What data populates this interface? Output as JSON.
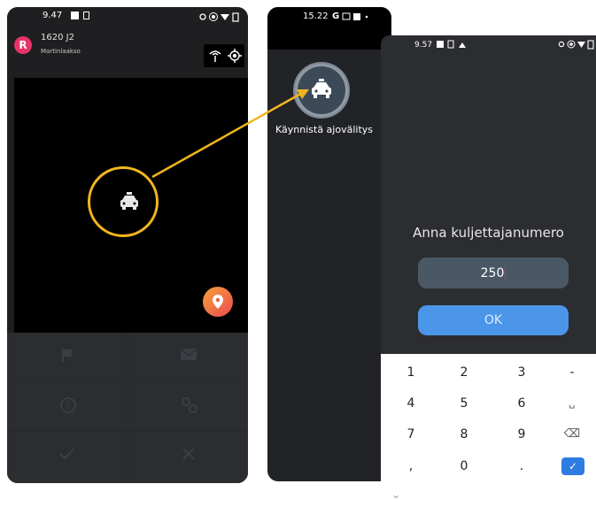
{
  "phone1": {
    "status_time": "9.47",
    "vehicle_id": "1620 J2",
    "area": "Martinlaakso",
    "avatar_letter": "R",
    "icons": [
      "antenna-icon",
      "gps-icon",
      "taxi-icon",
      "location-pin-icon",
      "flag-icon",
      "mail-icon",
      "help-icon",
      "settings-icon",
      "check-icon",
      "close-icon"
    ]
  },
  "phone2": {
    "status_time": "15.22",
    "status_g": "G",
    "app_label": "Käynnistä ajovälitys"
  },
  "phone3": {
    "status_time": "9.57",
    "dialog_title": "Anna kuljettajanumero",
    "input_value": "250",
    "ok_label": "OK",
    "keys": [
      "1",
      "2",
      "3",
      "-",
      "4",
      "5",
      "6",
      "␣",
      "7",
      "8",
      "9",
      "⌫",
      ",",
      "0",
      ".",
      "✓"
    ],
    "collapse_glyph": "⌄"
  },
  "colors": {
    "highlight": "#f2b61c",
    "avatar": "#e8336b",
    "ok_button": "#4b96e8",
    "input_bg": "#4a5866",
    "caret": "#e3245f"
  }
}
